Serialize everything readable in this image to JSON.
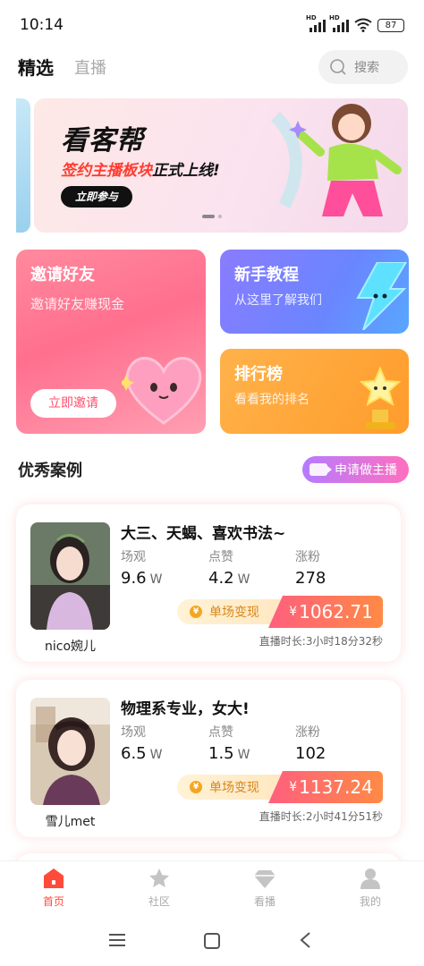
{
  "status_bar": {
    "time": "10:14",
    "battery": "87",
    "network_1": "HD",
    "network_2": "HD"
  },
  "header": {
    "tab_featured": "精选",
    "tab_live": "直播",
    "search_placeholder": "搜索"
  },
  "banner": {
    "title": "看客帮",
    "subtitle_highlight": "签约主播板块",
    "subtitle_rest": "正式上线!",
    "button": "立即参与"
  },
  "feature_cards": {
    "invite": {
      "title": "邀请好友",
      "desc": "邀请好友赚现金",
      "button": "立即邀请"
    },
    "guide": {
      "title": "新手教程",
      "desc": "从这里了解我们"
    },
    "rank": {
      "title": "排行榜",
      "desc": "看看我的排名"
    }
  },
  "section": {
    "title": "优秀案例",
    "apply_button": "申请做主播"
  },
  "cases": [
    {
      "name": "nico婉儿",
      "title": "大三、天蝎、喜欢书法~",
      "stats": [
        {
          "label": "场观",
          "value": "9.6",
          "unit": "W"
        },
        {
          "label": "点赞",
          "value": "4.2",
          "unit": "W"
        },
        {
          "label": "涨粉",
          "value": "278",
          "unit": ""
        }
      ],
      "earn_label": "单场变现",
      "currency": "¥",
      "amount": "1062.71",
      "duration": "直播时长:3小时18分32秒"
    },
    {
      "name": "雪儿met",
      "title": "物理系专业，女大!",
      "stats": [
        {
          "label": "场观",
          "value": "6.5",
          "unit": "W"
        },
        {
          "label": "点赞",
          "value": "1.5",
          "unit": "W"
        },
        {
          "label": "涨粉",
          "value": "102",
          "unit": ""
        }
      ],
      "earn_label": "单场变现",
      "currency": "¥",
      "amount": "1137.24",
      "duration": "直播时长:2小时41分51秒"
    }
  ],
  "bottom_nav": [
    {
      "label": "首页",
      "icon": "home-icon",
      "active": true
    },
    {
      "label": "社区",
      "icon": "star-icon",
      "active": false
    },
    {
      "label": "看播",
      "icon": "diamond-icon",
      "active": false
    },
    {
      "label": "我的",
      "icon": "user-icon",
      "active": false
    }
  ],
  "colors": {
    "accent": "#ff4b3a",
    "earn_gradient_start": "#ff5f7e",
    "earn_gradient_end": "#ff8a45"
  }
}
